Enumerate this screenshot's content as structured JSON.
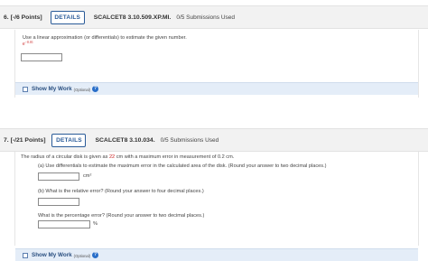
{
  "q1": {
    "number": "6.",
    "points": "[-/6 Points]",
    "details_label": "DETAILS",
    "code": "SCALCET8 3.10.509.XP.MI.",
    "submissions": "0/5 Submissions Used",
    "prompt": "Use a linear approximation (or differentials) to estimate the given number.",
    "expr_base": "e",
    "expr_exp": "−0.01",
    "answer": "",
    "show_my_work": "Show My Work",
    "optional": "(Optional)",
    "help": "?"
  },
  "q2": {
    "number": "7.",
    "points": "[-/21 Points]",
    "details_label": "DETAILS",
    "code": "SCALCET8 3.10.034.",
    "submissions": "0/5 Submissions Used",
    "prompt_pre": "The radius of a circular disk is given as ",
    "radius": "22",
    "prompt_post": " cm with a maximum error in measurement of 0.2 cm.",
    "part_a": "(a) Use differentials to estimate the maximum error in the calculated area of the disk. (Round your answer to two decimal places.)",
    "unit_a": "cm²",
    "part_b": "(b) What is the relative error? (Round your answer to four decimal places.)",
    "part_c": "What is the percentage error? (Round your answer to two decimal places.)",
    "unit_c": "%",
    "answer_a": "",
    "answer_b": "",
    "answer_c": "",
    "show_my_work": "Show My Work",
    "optional": "(Optional)",
    "help": "?"
  },
  "colors": {
    "header_bg": "#f2f2f2",
    "details_blue": "#2a5b98",
    "highlight_red": "#cc2222",
    "show_work_bg": "#e4edf8"
  }
}
